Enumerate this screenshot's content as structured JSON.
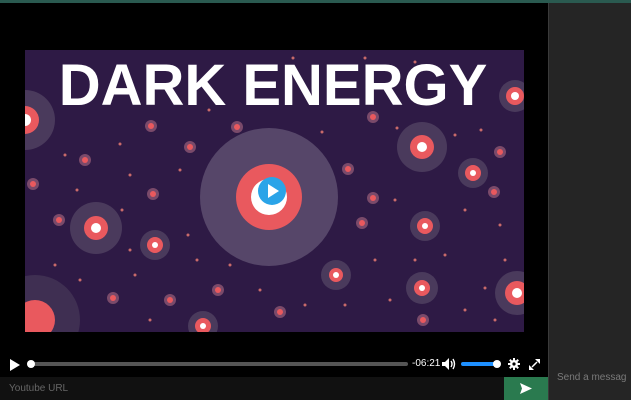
{
  "video": {
    "title_overlay": "DARK ENERGY",
    "time_remaining": "-06:21",
    "progress": 0.0,
    "volume": 1.0
  },
  "icons": {
    "play": "play-icon",
    "volume": "volume-icon",
    "settings": "gear-icon",
    "fullscreen": "fullscreen-icon",
    "send": "send-icon",
    "big_play": "play-icon"
  },
  "url_bar": {
    "placeholder": "Youtube URL",
    "value": ""
  },
  "chat": {
    "placeholder": "Send a message"
  },
  "colors": {
    "accent": "#2a7a4f",
    "volume_fill": "#1e90ff",
    "video_bg": "#2e1a45",
    "big_play": "#2aa4e8"
  }
}
